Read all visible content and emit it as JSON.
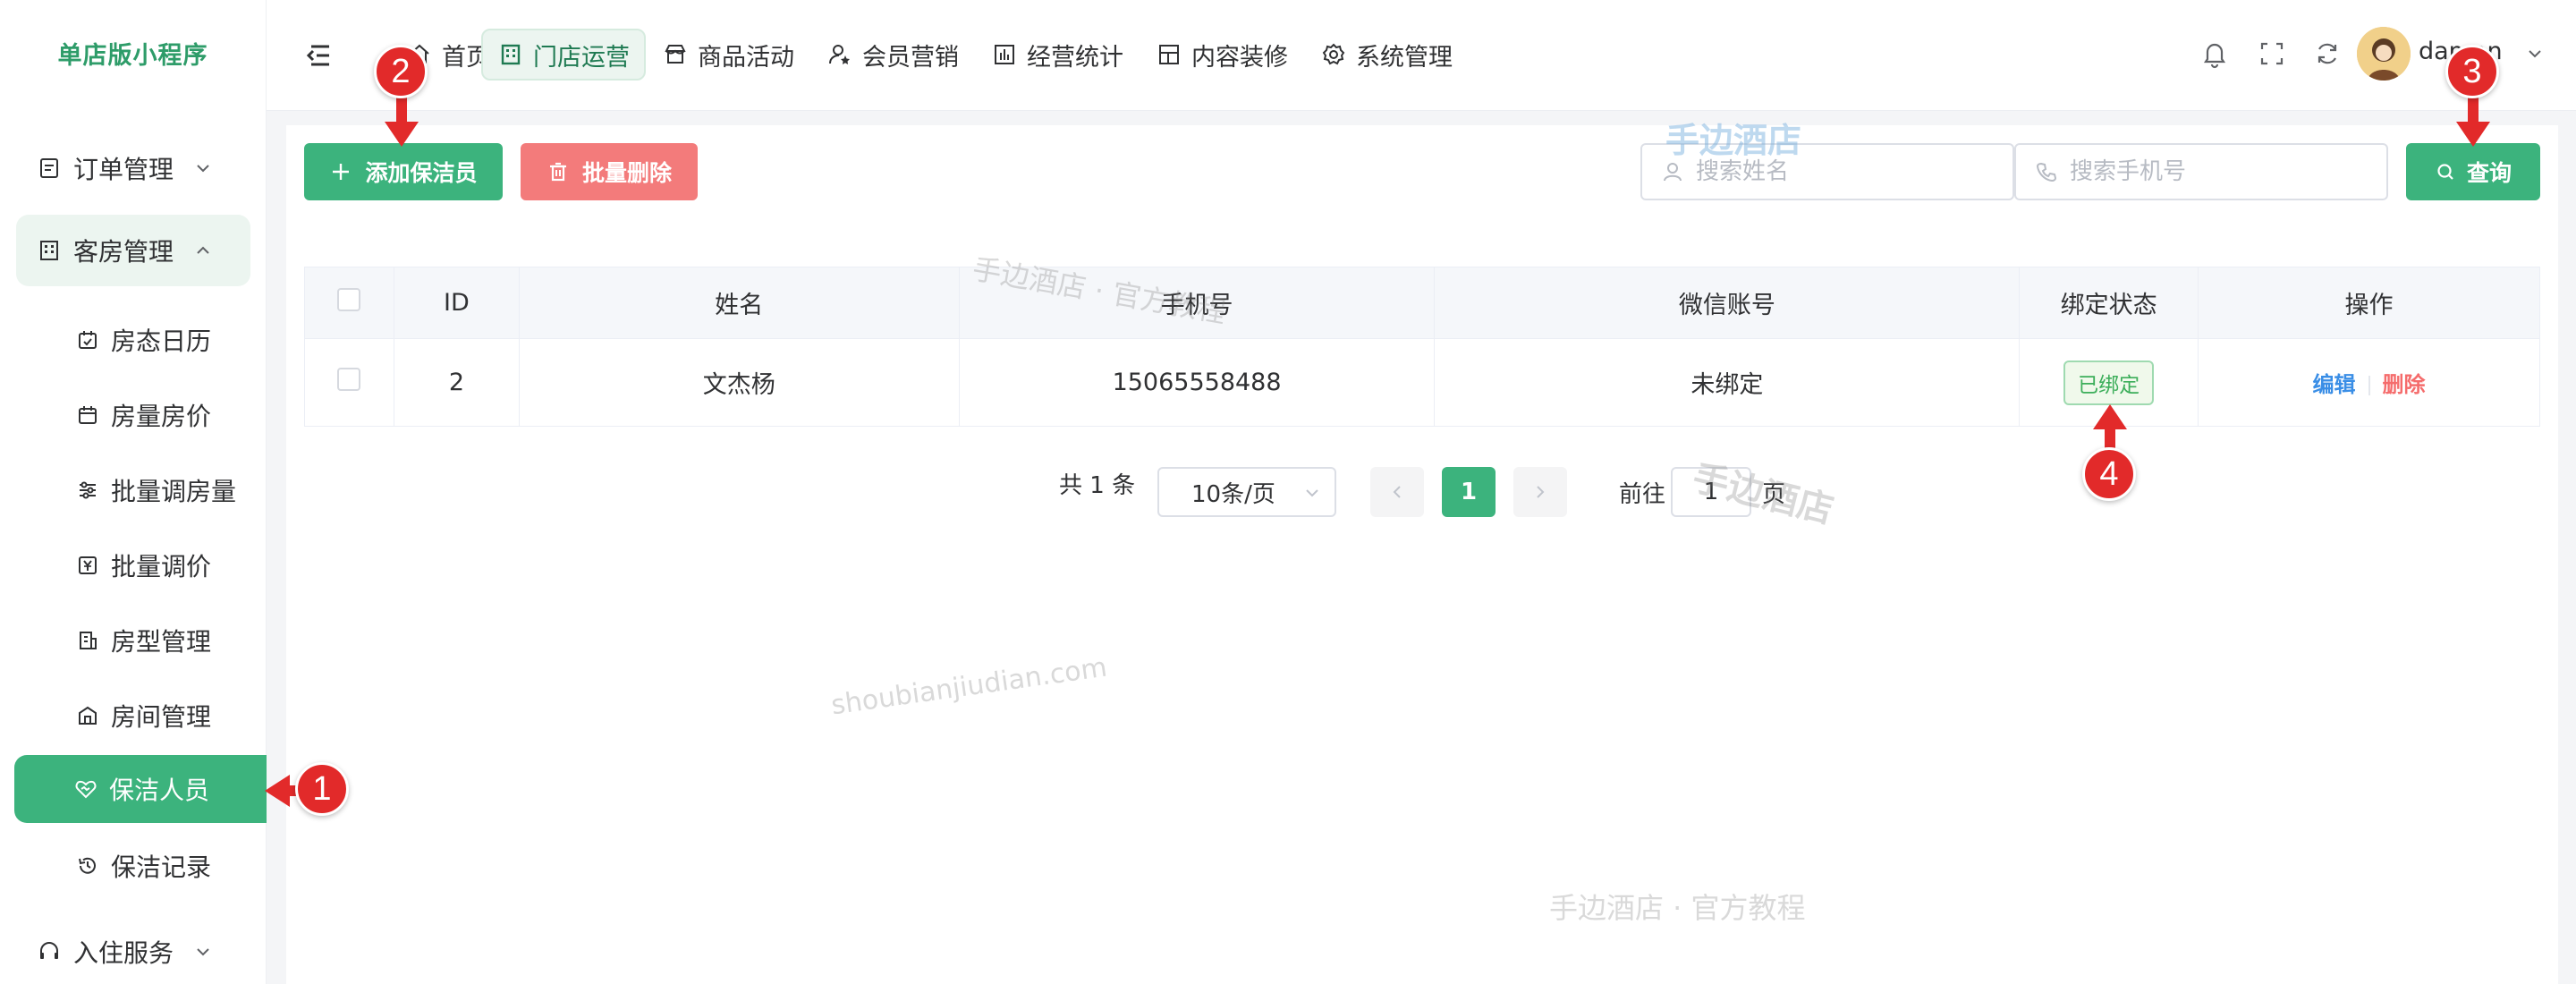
{
  "sidebar": {
    "brand": "单店版小程序",
    "groups": [
      {
        "label": "订单管理"
      },
      {
        "label": "客房管理"
      },
      {
        "label": "入住服务"
      }
    ],
    "sub_items": [
      {
        "label": "房态日历"
      },
      {
        "label": "房量房价"
      },
      {
        "label": "批量调房量"
      },
      {
        "label": "批量调价"
      },
      {
        "label": "房型管理"
      },
      {
        "label": "房间管理"
      },
      {
        "label": "保洁人员"
      },
      {
        "label": "保洁记录"
      }
    ]
  },
  "topnav": {
    "tabs": [
      {
        "label": "首页"
      },
      {
        "label": "门店运营"
      },
      {
        "label": "商品活动"
      },
      {
        "label": "会员营销"
      },
      {
        "label": "经营统计"
      },
      {
        "label": "内容装修"
      },
      {
        "label": "系统管理"
      }
    ],
    "username": "daman"
  },
  "toolbar": {
    "add_label": "添加保洁员",
    "batch_delete_label": "批量删除",
    "search_name_placeholder": "搜索姓名",
    "search_phone_placeholder": "搜索手机号",
    "query_label": "查询"
  },
  "table": {
    "headers": [
      "ID",
      "姓名",
      "手机号",
      "微信账号",
      "绑定状态",
      "操作"
    ],
    "rows": [
      {
        "id": "2",
        "name": "文杰杨",
        "phone": "15065558488",
        "wechat": "未绑定",
        "status": "已绑定",
        "edit": "编辑",
        "delete": "删除"
      }
    ]
  },
  "pagination": {
    "total": "共 1 条",
    "page_size": "10条/页",
    "current_page": "1",
    "goto_prefix": "前往",
    "goto_value": "1",
    "goto_suffix": "页"
  },
  "watermarks": {
    "brand": "手边酒店",
    "tutorial": "手边酒店 · 官方教程",
    "domain": "shoubianjiudian.com"
  },
  "markers": [
    "1",
    "2",
    "3",
    "4"
  ],
  "colors": {
    "primary": "#3cb37d",
    "danger": "#f37b7b",
    "marker": "#e22a2a",
    "link": "#3a8ee6"
  }
}
